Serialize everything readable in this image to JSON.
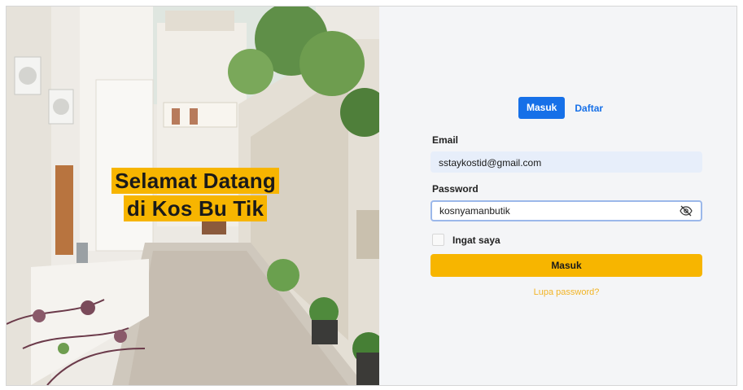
{
  "welcome": {
    "line1": "Selamat Datang",
    "line2": "di Kos Bu Tik"
  },
  "tabs": {
    "login_label": "Masuk",
    "register_label": "Daftar"
  },
  "form": {
    "email_label": "Email",
    "email_value": "sstaykostid@gmail.com",
    "password_label": "Password",
    "password_value": "kosnyamanbutik",
    "password_toggle_icon": "eye-slash-icon",
    "remember_label": "Ingat saya",
    "remember_checked": false,
    "submit_label": "Masuk",
    "forgot_label": "Lupa password?"
  },
  "colors": {
    "accent_blue": "#1670e8",
    "accent_yellow": "#f7b500",
    "link_yellow": "#f2b425"
  }
}
